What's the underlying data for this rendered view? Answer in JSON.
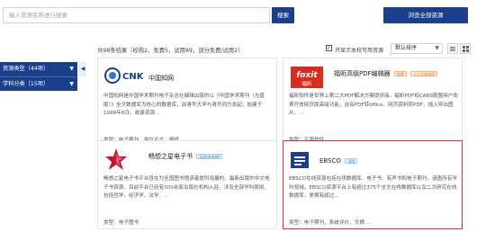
{
  "search": {
    "placeholder": "输入资源名称进行搜索",
    "button_label": "搜索",
    "browse_all_label": "浏览全部资源"
  },
  "results": {
    "summary": "共98条结果（校购2，免费5，试用89，部分免费/试用2）",
    "free_only_label": "只显示本校可用资源",
    "free_only_checked": true,
    "sort_label": "默认排序"
  },
  "sidebar": {
    "items": [
      {
        "label": "资源类型（44项）"
      },
      {
        "label": "学科分类（15项）"
      }
    ]
  },
  "cards": [
    {
      "title": "中国知网",
      "logo_text": "CNKi",
      "desc": "中国知网是中国学术期刊电子杂志社编辑出版的以《中国学术期刊（光盘版）》全文数据库为核心的数据库，由清华大学与清华同方发起，始建于1999年6月。收录资源...",
      "type": "类型：电子期刊，学位论文，报纸",
      "tags": [],
      "selected": false
    },
    {
      "title": "福昕高级PDF编辑器",
      "logo_text": "foxit",
      "logo_sub": "福昕",
      "desc": "福昕软件是世界上第二大PDF解决方案提供商。福昕PDF和CARS联盟用户免费开放网页版高级功能，含有PDF转office、网页资料转PDF、插入导出图片、...",
      "type": "类型：正版软件",
      "tags": [
        {
          "label": "免费"
        },
        {
          "label": "个人开放使用"
        }
      ],
      "selected": false
    },
    {
      "title": "畅想之星电子书",
      "desc": "畅想之星电子书平台旨在为全国图书馆读者提供海量的、最新出版的中文电子书资源，目前平台已经有500余家出版社机构入驻。涉及全部学科类别，包括哲学、经济学、法学、...",
      "type": "类型：电子图书",
      "tags": [
        {
          "label": "试用(有效期)"
        }
      ],
      "selected": false
    },
    {
      "title": "EBSCO",
      "logo_text": "EBSCO",
      "desc": "EBSCO在线资源包括在线数据库、电子书、有声书和电子期刊，涵盖所有学科领域。EBSCO资源平台上有超过375个全文在线数据库以及二次研究在线数据库，更拥有超过...",
      "type": "类型：电子期刊，系统评价，文摘 ...",
      "tags": [
        {
          "label": "试用"
        }
      ],
      "selected": true
    }
  ],
  "colors": {
    "brand_blue": "#1c3f8c",
    "selected_border": "#e0302c",
    "foxit_red": "#d62d20"
  }
}
